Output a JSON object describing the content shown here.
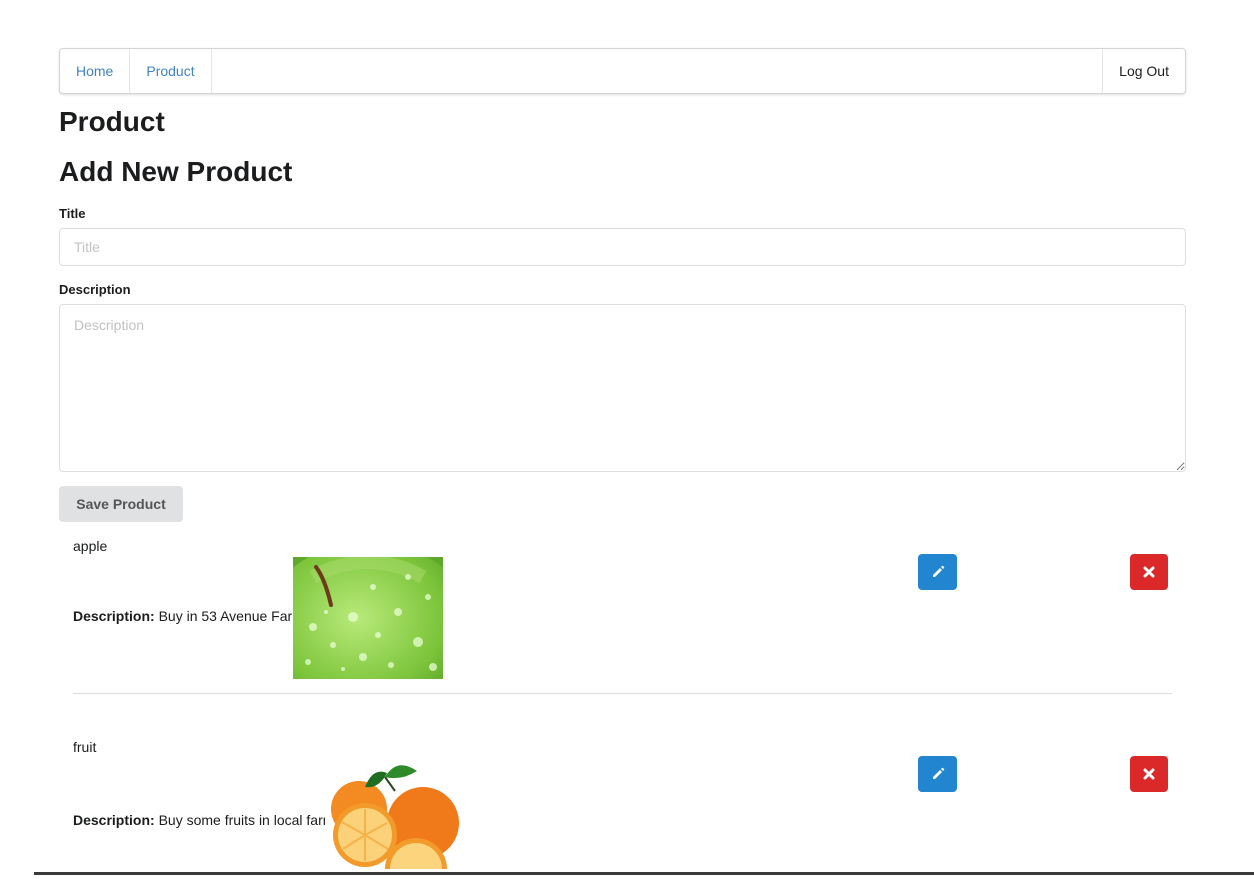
{
  "nav": {
    "home": "Home",
    "product": "Product",
    "logout": "Log Out"
  },
  "page": {
    "title": "Product",
    "form_title": "Add New Product"
  },
  "form": {
    "title_label": "Title",
    "title_placeholder": "Title",
    "title_value": "",
    "description_label": "Description",
    "description_placeholder": "Description",
    "description_value": "",
    "save_label": "Save Product"
  },
  "products": [
    {
      "name": "apple",
      "description_label": "Description:",
      "description": "Buy in 53 Avenue Farm",
      "image_icon": "green-apple-image"
    },
    {
      "name": "fruit",
      "description_label": "Description:",
      "description": "Buy some fruits in local farm",
      "image_icon": "oranges-image"
    }
  ],
  "colors": {
    "link": "#4183c4",
    "edit": "#2185d0",
    "delete": "#db2828",
    "save_bg": "#e0e1e2"
  }
}
